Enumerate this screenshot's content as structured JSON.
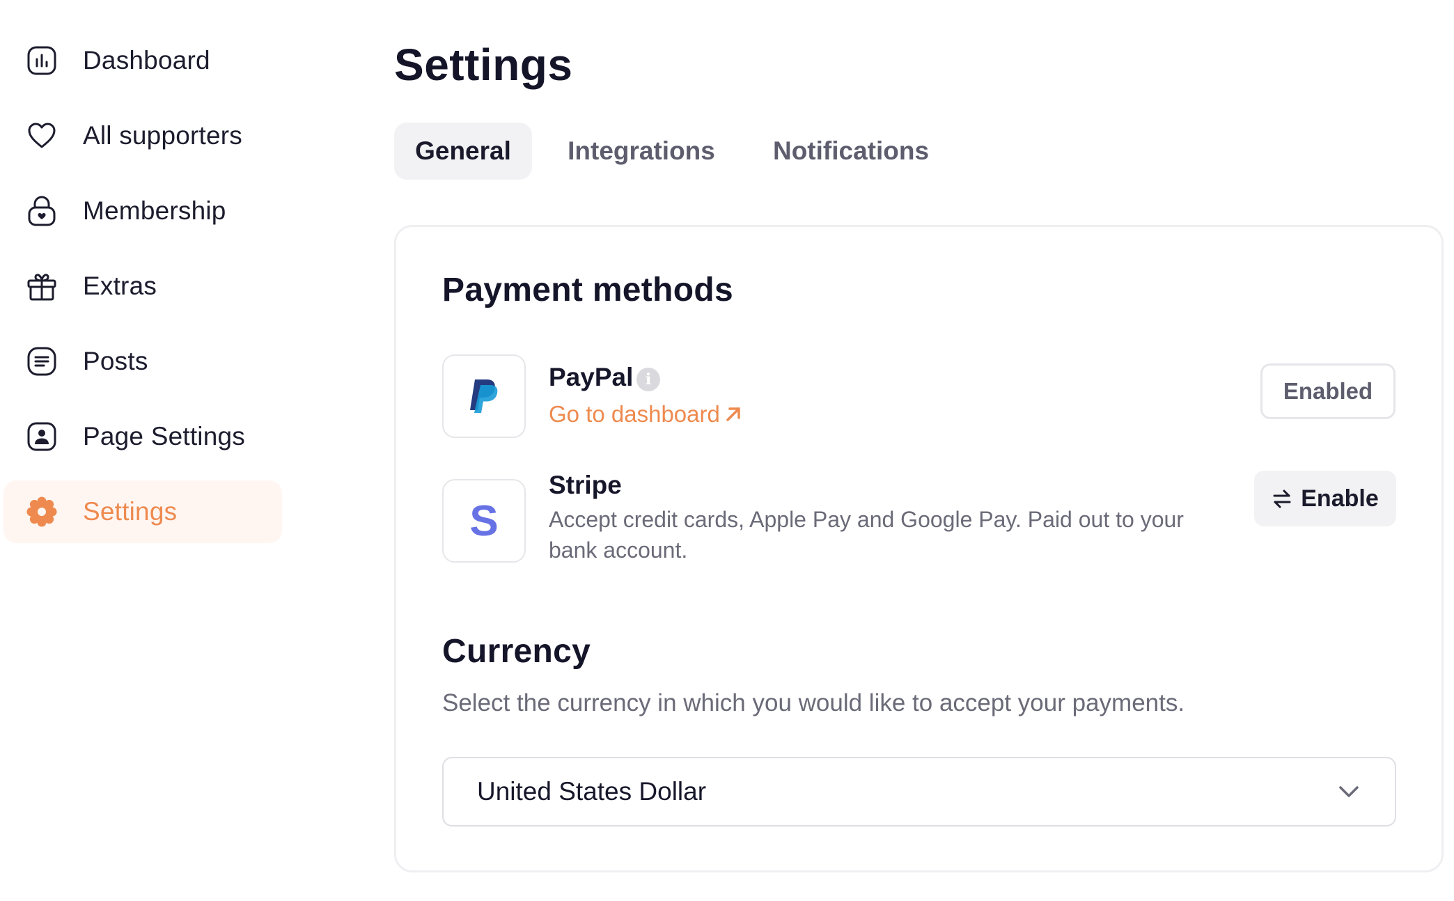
{
  "sidebar": {
    "items": [
      {
        "label": "Dashboard",
        "icon": "dashboard-icon"
      },
      {
        "label": "All supporters",
        "icon": "heart-icon"
      },
      {
        "label": "Membership",
        "icon": "lock-heart-icon"
      },
      {
        "label": "Extras",
        "icon": "gift-icon"
      },
      {
        "label": "Posts",
        "icon": "document-icon"
      },
      {
        "label": "Page Settings",
        "icon": "profile-icon"
      },
      {
        "label": "Settings",
        "icon": "gear-icon",
        "active": true
      }
    ]
  },
  "page": {
    "title": "Settings"
  },
  "tabs": [
    {
      "label": "General",
      "active": true
    },
    {
      "label": "Integrations"
    },
    {
      "label": "Notifications"
    }
  ],
  "payment": {
    "title": "Payment methods",
    "paypal": {
      "name": "PayPal",
      "info": "i",
      "link": "Go to dashboard",
      "button": "Enabled"
    },
    "stripe": {
      "name": "Stripe",
      "logo": "S",
      "description": "Accept credit cards, Apple Pay and Google Pay. Paid out to your bank account.",
      "button": "Enable"
    }
  },
  "currency": {
    "title": "Currency",
    "description": "Select the currency in which you would like to accept your payments.",
    "selected": "United States Dollar"
  },
  "colors": {
    "accent": "#ee8a4f",
    "active_bg": "#fff6f2",
    "paypal_dark": "#253b80",
    "paypal_light": "#179bd7",
    "stripe": "#6772e5"
  }
}
